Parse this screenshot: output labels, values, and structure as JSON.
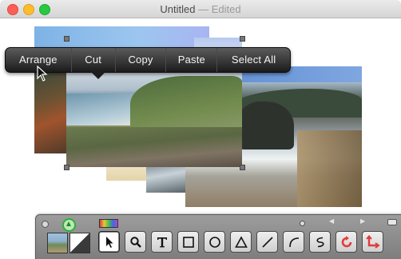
{
  "window": {
    "title": "Untitled",
    "status": "— Edited",
    "buttons": [
      "close",
      "minimize",
      "zoom"
    ]
  },
  "context_menu": {
    "items": [
      {
        "label": "Arrange"
      },
      {
        "label": "Cut"
      },
      {
        "label": "Copy"
      },
      {
        "label": "Paste"
      },
      {
        "label": "Select All"
      }
    ]
  },
  "palette": {
    "tools": [
      {
        "name": "arrow-select",
        "icon": "arrow-cursor-icon",
        "selected": true
      },
      {
        "name": "zoom",
        "icon": "magnifier-icon",
        "selected": false
      },
      {
        "name": "text",
        "icon": "text-t-icon",
        "selected": false
      },
      {
        "name": "rectangle",
        "icon": "square-icon",
        "selected": false
      },
      {
        "name": "oval",
        "icon": "circle-icon",
        "selected": false
      },
      {
        "name": "triangle",
        "icon": "triangle-icon",
        "selected": false
      },
      {
        "name": "line",
        "icon": "line-icon",
        "selected": false
      },
      {
        "name": "arc",
        "icon": "arc-icon",
        "selected": false
      },
      {
        "name": "curve",
        "icon": "s-curve-icon",
        "selected": false
      },
      {
        "name": "rotate",
        "icon": "rotate-icon",
        "selected": false
      },
      {
        "name": "crop",
        "icon": "crop-icon",
        "selected": false
      }
    ],
    "colors": {
      "accent_green": "#2fae3a",
      "rotate_red": "#e03c3c",
      "crop_red": "#e03c3c"
    }
  }
}
